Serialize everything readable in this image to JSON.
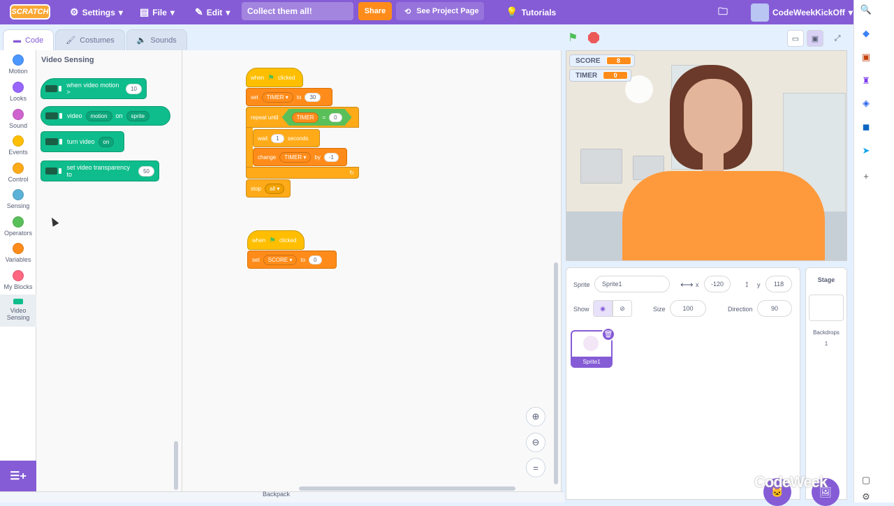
{
  "menubar": {
    "logo": "SCRATCH",
    "settings": "Settings",
    "file": "File",
    "edit": "Edit",
    "project_title": "Collect them all!",
    "share": "Share",
    "see_project": "See Project Page",
    "tutorials": "Tutorials",
    "username": "CodeWeekKickOff"
  },
  "tabs": {
    "code": "Code",
    "costumes": "Costumes",
    "sounds": "Sounds"
  },
  "categories": [
    {
      "label": "Motion",
      "color": "#4c97ff"
    },
    {
      "label": "Looks",
      "color": "#9966ff"
    },
    {
      "label": "Sound",
      "color": "#cf63cf"
    },
    {
      "label": "Events",
      "color": "#ffbf00"
    },
    {
      "label": "Control",
      "color": "#ffab19"
    },
    {
      "label": "Sensing",
      "color": "#5cb1d6"
    },
    {
      "label": "Operators",
      "color": "#59c059"
    },
    {
      "label": "Variables",
      "color": "#ff8c1a"
    },
    {
      "label": "My Blocks",
      "color": "#ff6680"
    },
    {
      "label": "Video Sensing",
      "color": "#0fbd8c"
    }
  ],
  "palette": {
    "title": "Video Sensing",
    "b1": {
      "text": "when video motion >",
      "value": "10"
    },
    "b2": {
      "t1": "video",
      "d1": "motion",
      "t2": "on",
      "d2": "sprite"
    },
    "b3": {
      "text": "turn video",
      "d1": "on"
    },
    "b4": {
      "text": "set video transparency to",
      "value": "50"
    }
  },
  "script1": {
    "when": "when",
    "clicked": "clicked",
    "set": "set",
    "var": "TIMER",
    "to": "to",
    "setval": "30",
    "repeat": "repeat until",
    "opvar": "TIMER",
    "eq": "=",
    "opval": "0",
    "wait": "wait",
    "waitval": "1",
    "seconds": "seconds",
    "change": "change",
    "chvar": "TIMER",
    "by": "by",
    "chval": "-1",
    "stop": "stop",
    "stopopt": "all"
  },
  "script2": {
    "when": "when",
    "clicked": "clicked",
    "set": "set",
    "var": "SCORE",
    "to": "to",
    "setval": "0"
  },
  "stage": {
    "monitors": [
      {
        "label": "SCORE",
        "value": "8"
      },
      {
        "label": "TIMER",
        "value": "0"
      }
    ]
  },
  "sprite_info": {
    "sprite_label": "Sprite",
    "sprite_name": "Sprite1",
    "x_label": "x",
    "x": "-120",
    "y_label": "y",
    "y": "118",
    "show_label": "Show",
    "size_label": "Size",
    "size": "100",
    "direction_label": "Direction",
    "direction": "90"
  },
  "sprites": [
    {
      "name": "Sprite1"
    }
  ],
  "stage_panel": {
    "title": "Stage",
    "backdrops_label": "Backdrops",
    "backdrops_count": "1"
  },
  "watermark": "CodeWeek",
  "bottom_label": "Backpack",
  "colors": {
    "accent": "#855cd6",
    "orange": "#ff8c1a",
    "video": "#0fbd8c"
  }
}
